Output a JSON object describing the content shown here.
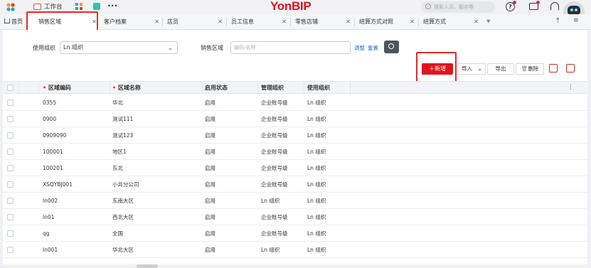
{
  "topbar": {
    "workbench_label": "工作台",
    "more_label": "•••",
    "brand": "YonBIP",
    "search_placeholder": "搜索人员、服务等"
  },
  "tabs": [
    {
      "label": "首页",
      "closable": false
    },
    {
      "label": "销售区域",
      "closable": true,
      "active": true
    },
    {
      "label": "客户档案",
      "closable": true
    },
    {
      "label": "店员",
      "closable": true
    },
    {
      "label": "员工信息",
      "closable": true
    },
    {
      "label": "零售店铺",
      "closable": true
    },
    {
      "label": "结算方式对照",
      "closable": true
    },
    {
      "label": "结算方式",
      "closable": true
    }
  ],
  "filters": {
    "org_label": "使用组织",
    "org_value": "Ln 组织",
    "region_label": "销售区域",
    "region_placeholder": "编码/名称",
    "adjust_label": "调整",
    "reset_label": "重置"
  },
  "toolbar": {
    "new_label": "新增",
    "import_label": "导入",
    "export_label": "导出",
    "delete_label": "删除"
  },
  "table": {
    "columns": [
      "区域编码",
      "区域名称",
      "启用状态",
      "管理组织",
      "使用组织"
    ],
    "required": [
      true,
      true,
      false,
      false,
      false
    ],
    "rows": [
      [
        "0355",
        "华北",
        "启用",
        "企业账号级",
        "Ln 组织"
      ],
      [
        "0900",
        "测试111",
        "启用",
        "企业账号级",
        "Ln 组织"
      ],
      [
        "0909090",
        "测试123",
        "启用",
        "企业账号级",
        "Ln 组织"
      ],
      [
        "100001",
        "地区1",
        "启用",
        "企业账号级",
        "Ln 组织"
      ],
      [
        "100201",
        "东北",
        "启用",
        "企业账号级",
        "Ln 组织"
      ],
      [
        "XSQYBJ001",
        "小井分公司",
        "启用",
        "企业账号级",
        "Ln 组织"
      ],
      [
        "ln002",
        "东南大区",
        "启用",
        "Ln 组织",
        "Ln 组织"
      ],
      [
        "ln01",
        "西北大区",
        "启用",
        "企业账号级",
        "Ln 组织"
      ],
      [
        "qg",
        "全国",
        "启用",
        "企业账号级",
        "Ln 组织"
      ],
      [
        "ln001",
        "华北大区",
        "启用",
        "Ln 组织",
        "Ln 组织"
      ]
    ]
  },
  "colors": {
    "brand_red": "#e0141e",
    "highlight_red": "#e52a2a",
    "search_btn": "#4d5561"
  }
}
